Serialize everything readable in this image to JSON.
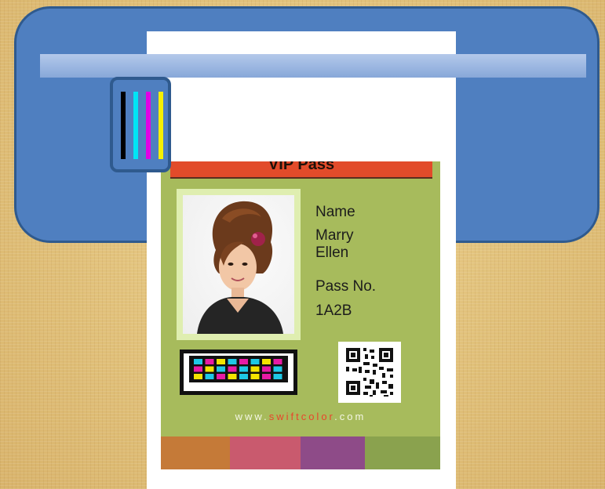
{
  "illustration": "id-card-printer",
  "colors": {
    "background": "#e2c27e",
    "printer_body": "#4f7fc0",
    "printer_border": "#2f5a8e",
    "rail": "#9db8e2",
    "card_background": "#a7bb5c",
    "card_header": "#e24b2a",
    "ink_black": "#000000",
    "ink_cyan": "#00e5f5",
    "ink_magenta": "#e100e6",
    "ink_yellow": "#f6f000"
  },
  "card": {
    "header_title": "VIP Pass",
    "name_label": "Name",
    "name_first": "Marry",
    "name_last": "Ellen",
    "pass_label": "Pass No.",
    "pass_number": "1A2B",
    "website_prefix": "www.",
    "website_brand": "swiftcolor",
    "website_suffix": ".com",
    "bottom_stripe_colors": [
      "#c57a38",
      "#c95a6e",
      "#8e4b88",
      "#8aa24e"
    ]
  },
  "icons": [
    "ink-cartridge-icon",
    "printer-icon",
    "qr-code-icon",
    "photo-icon"
  ]
}
